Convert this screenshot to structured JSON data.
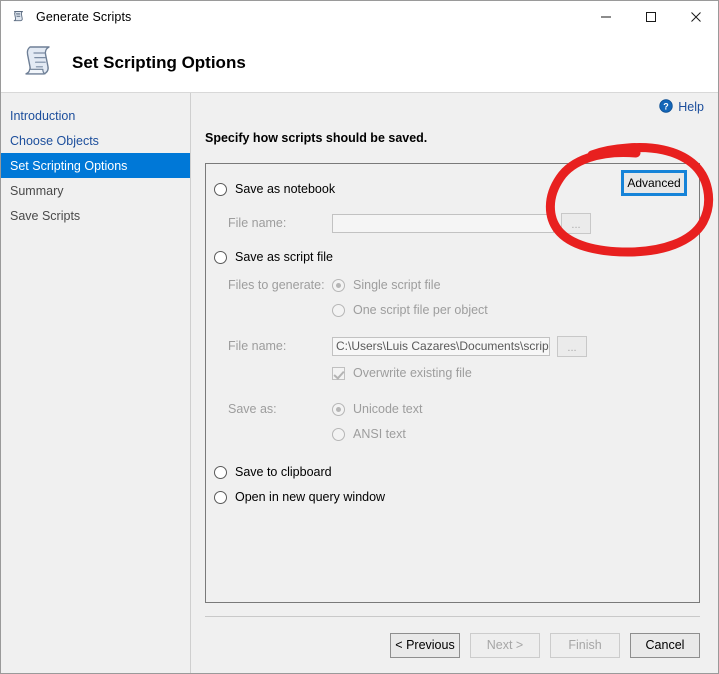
{
  "window": {
    "title": "Generate Scripts",
    "icon": "scroll-icon",
    "controls": {
      "minimize": "minimize-icon",
      "maximize": "maximize-icon",
      "close": "close-icon"
    }
  },
  "header": {
    "title": "Set Scripting Options",
    "icon": "scroll-icon"
  },
  "sidebar": {
    "items": [
      {
        "label": "Introduction",
        "state": "done"
      },
      {
        "label": "Choose Objects",
        "state": "done"
      },
      {
        "label": "Set Scripting Options",
        "state": "active"
      },
      {
        "label": "Summary",
        "state": "future"
      },
      {
        "label": "Save Scripts",
        "state": "future"
      }
    ]
  },
  "content": {
    "help_label": "Help",
    "help_icon": "help-circle-icon",
    "instruction": "Specify how scripts should be saved.",
    "advanced_button": "Advanced",
    "notebook": {
      "radio_label": "Save as notebook",
      "selected": false,
      "file_name_label": "File name:",
      "file_name_value": "",
      "browse_label": "...",
      "enabled": false
    },
    "script_file": {
      "radio_label": "Save as script file",
      "selected": false,
      "files_to_generate_label": "Files to generate:",
      "options": [
        {
          "label": "Single script file",
          "selected": true
        },
        {
          "label": "One script file per object",
          "selected": false
        }
      ],
      "file_name_label": "File name:",
      "file_name_value": "C:\\Users\\Luis Cazares\\Documents\\script.sql",
      "browse_label": "...",
      "overwrite_label": "Overwrite existing file",
      "overwrite_checked": true,
      "save_as_label": "Save as:",
      "encodings": [
        {
          "label": "Unicode text",
          "selected": true
        },
        {
          "label": "ANSI text",
          "selected": false
        }
      ],
      "enabled": false
    },
    "clipboard": {
      "radio_label": "Save to clipboard",
      "selected": false
    },
    "new_query": {
      "radio_label": "Open in new query window",
      "selected": false
    }
  },
  "footer": {
    "buttons": [
      {
        "label": "< Previous",
        "enabled": true
      },
      {
        "label": "Next >",
        "enabled": false
      },
      {
        "label": "Finish",
        "enabled": false
      },
      {
        "label": "Cancel",
        "enabled": true
      }
    ]
  },
  "annotation": {
    "type": "hand-drawn-ellipse",
    "color": "#e8201f",
    "target": "advanced-button"
  },
  "colors": {
    "accent": "#0078d7",
    "link": "#1c4e9c",
    "annotation_red": "#e8201f",
    "focus_blue": "#1683d8",
    "window_bg": "#f0f0f0"
  }
}
